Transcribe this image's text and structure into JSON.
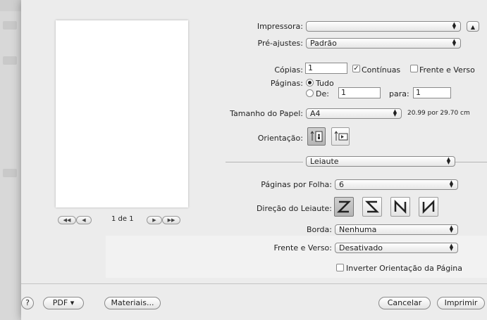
{
  "printer": {
    "label": "Impressora:",
    "value": ""
  },
  "presets": {
    "label": "Pré-ajustes:",
    "value": "Padrão"
  },
  "copies": {
    "label": "Cópias:",
    "value": "1",
    "collated_label": "Contínuas",
    "collated": true,
    "duplex_label": "Frente e Verso",
    "duplex": false
  },
  "pages": {
    "label": "Páginas:",
    "all_label": "Tudo",
    "from_label": "De:",
    "from_value": "1",
    "to_label": "para:",
    "to_value": "1",
    "selected": "all"
  },
  "paper_size": {
    "label": "Tamanho do Papel:",
    "value": "A4",
    "dimensions": "20.99 por 29.70 cm"
  },
  "orientation": {
    "label": "Orientação:"
  },
  "section": {
    "value": "Leiaute"
  },
  "layout": {
    "pages_per_sheet_label": "Páginas por Folha:",
    "pages_per_sheet": "6",
    "direction_label": "Direção do Leiaute:",
    "border_label": "Borda:",
    "border": "Nenhuma",
    "two_sided_label": "Frente e Verso:",
    "two_sided": "Desativado",
    "reverse_label": "Inverter Orientação da Página",
    "reverse": false
  },
  "preview": {
    "page_indicator": "1 de 1"
  },
  "footer": {
    "help": "?",
    "pdf": "PDF ▾",
    "supplies": "Materiais...",
    "cancel": "Cancelar",
    "print": "Imprimir"
  }
}
